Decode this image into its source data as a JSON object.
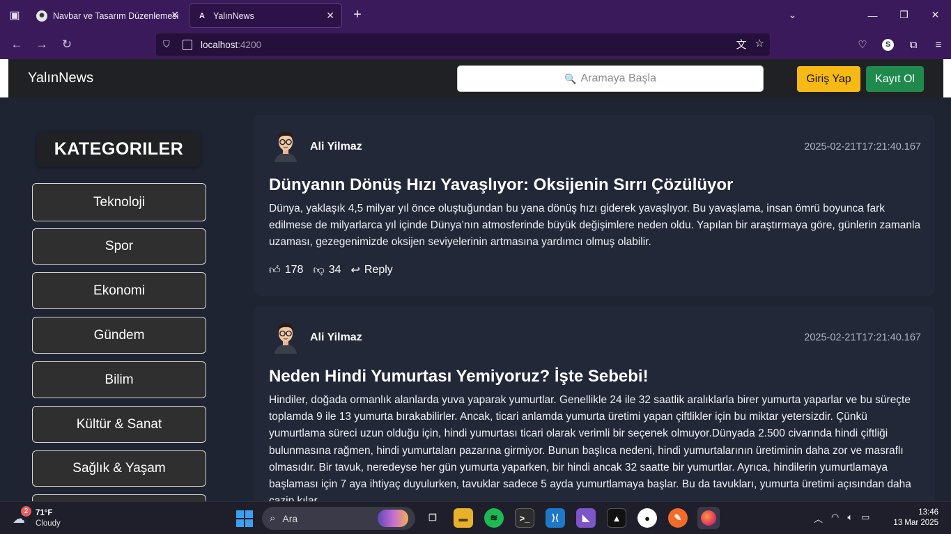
{
  "browser": {
    "tabs": [
      {
        "title": "Navbar ve Tasarım Düzenlemesi",
        "favicon": "chatgpt-icon"
      },
      {
        "title": "YalınNews",
        "favicon": "angular-icon"
      }
    ],
    "url_host": "localhost",
    "url_port": ":4200",
    "profile_letter": "S"
  },
  "app": {
    "brand": "YalınNews",
    "search_placeholder": "Aramaya Başla",
    "login_label": "Giriş Yap",
    "register_label": "Kayıt Ol",
    "categories_title": "KATEGORILER",
    "categories": [
      "Teknoloji",
      "Spor",
      "Ekonomi",
      "Gündem",
      "Bilim",
      "Kültür & Sanat",
      "Sağlık & Yaşam"
    ]
  },
  "posts": [
    {
      "author": "Ali Yilmaz",
      "date": "2025-02-21T17:21:40.167",
      "title": "Dünyanın Dönüş Hızı Yavaşlıyor: Oksijenin Sırrı Çözülüyor",
      "body": "Dünya, yaklaşık 4,5 milyar yıl önce oluştuğundan bu yana dönüş hızı giderek yavaşlıyor. Bu yavaşlama, insan ömrü boyunca fark edilmese de milyarlarca yıl içinde Dünya’nın atmosferinde büyük değişimlere neden oldu. Yapılan bir araştırmaya göre, günlerin zamanla uzaması, gezegenimizde oksijen seviyelerinin artmasına yardımcı olmuş olabilir.",
      "likes": "178",
      "dislikes": "34",
      "reply_label": "Reply"
    },
    {
      "author": "Ali Yilmaz",
      "date": "2025-02-21T17:21:40.167",
      "title": "Neden Hindi Yumurtası Yemiyoruz? İşte Sebebi!",
      "body": "Hindiler, doğada ormanlık alanlarda yuva yaparak yumurtlar. Genellikle 24 ile 32 saatlik aralıklarla birer yumurta yaparlar ve bu süreçte toplamda 9 ile 13 yumurta bırakabilirler. Ancak, ticari anlamda yumurta üretimi yapan çiftlikler için bu miktar yetersizdir. Çünkü yumurtlama süreci uzun olduğu için, hindi yumurtası ticari olarak verimli bir seçenek olmuyor.Dünyada 2.500 civarında hindi çiftliği bulunmasına rağmen, hindi yumurtaları pazarına girmiyor. Bunun başlıca nedeni, hindi yumurtalarının üretiminin daha zor ve masraflı olmasıdır. Bir tavuk, neredeyse her gün yumurta yaparken, bir hindi ancak 32 saatte bir yumurtlar. Ayrıca, hindilerin yumurtlamaya başlaması için 7 aya ihtiyaç duyulurken, tavuklar sadece 5 ayda yumurtlamaya başlar. Bu da tavukları, yumurta üretimi açısından daha cazip kılar."
    }
  ],
  "taskbar": {
    "weather_badge": "2",
    "temperature": "71°F",
    "condition": "Cloudy",
    "search_label": "Ara",
    "time": "13:46",
    "date": "13 Mar 2025"
  }
}
